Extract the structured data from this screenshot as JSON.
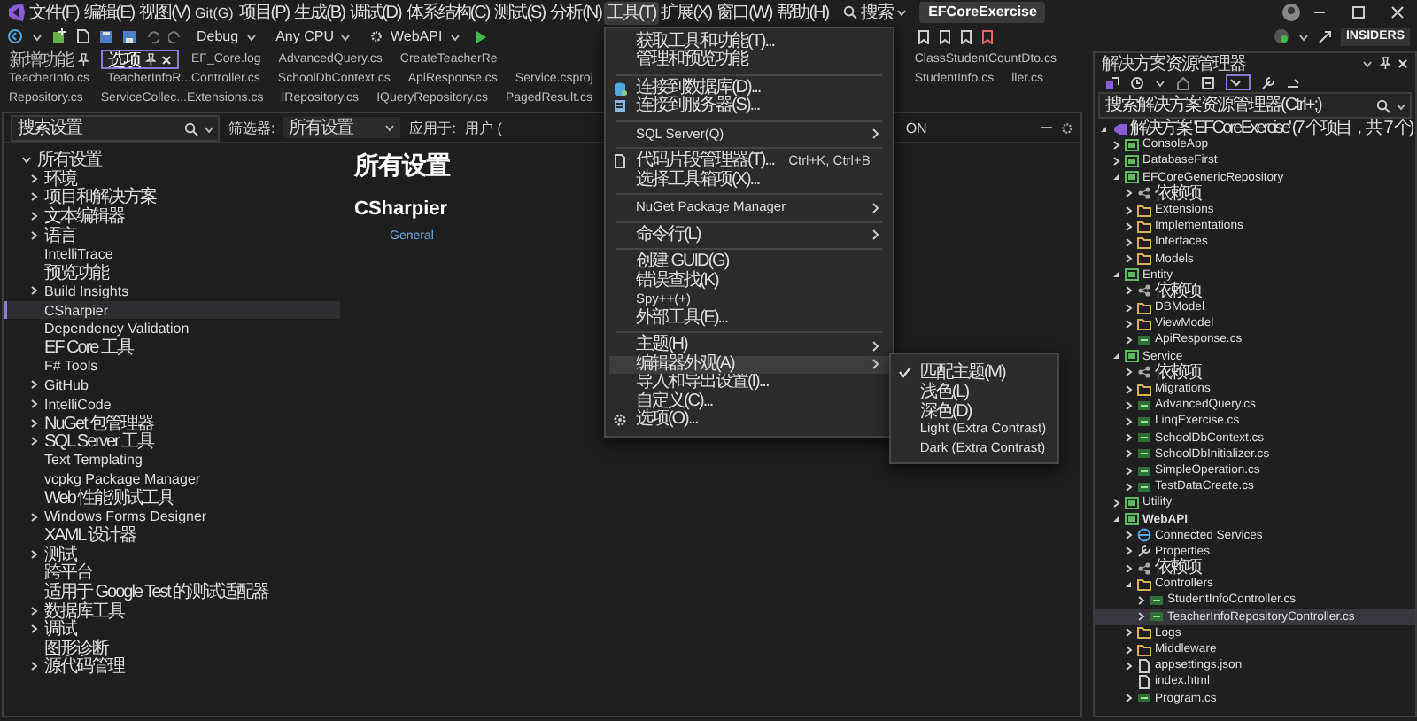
{
  "menubar": {
    "menus": [
      {
        "label": "文件(F)",
        "selected": false
      },
      {
        "label": "编辑(E)",
        "selected": false
      },
      {
        "label": "视图(V)",
        "selected": false
      },
      {
        "label": "Git(G)",
        "selected": false
      },
      {
        "label": "项目(P)",
        "selected": false
      },
      {
        "label": "生成(B)",
        "selected": false
      },
      {
        "label": "调试(D)",
        "selected": false
      },
      {
        "label": "体系结构(C)",
        "selected": false
      },
      {
        "label": "测试(S)",
        "selected": false
      },
      {
        "label": "分析(N)",
        "selected": false
      },
      {
        "label": "工具(T)",
        "selected": true
      },
      {
        "label": "扩展(X)",
        "selected": false
      },
      {
        "label": "窗口(W)",
        "selected": false
      },
      {
        "label": "帮助(H)",
        "selected": false
      }
    ],
    "search": "搜索",
    "title": "EFCoreExercise"
  },
  "tools_menu": [
    {
      "kind": "item",
      "label": "获取工具和功能(T)...",
      "selected": false
    },
    {
      "kind": "item",
      "label": "管理和预览功能",
      "selected": false
    },
    {
      "kind": "separator"
    },
    {
      "kind": "item",
      "label": "连接到数据库(D)...",
      "selected": false
    },
    {
      "kind": "item",
      "label": "连接到服务器(S)...",
      "selected": false
    },
    {
      "kind": "separator"
    },
    {
      "kind": "item",
      "label": "SQL Server(Q)",
      "submenu": true,
      "selected": false
    },
    {
      "kind": "separator"
    },
    {
      "kind": "item",
      "label": "代码片段管理器(T)...",
      "shortcut": "Ctrl+K, Ctrl+B",
      "selected": false
    },
    {
      "kind": "item",
      "label": "选择工具箱项(X)...",
      "selected": false
    },
    {
      "kind": "separator"
    },
    {
      "kind": "item",
      "label": "NuGet Package Manager",
      "submenu": true,
      "selected": false
    },
    {
      "kind": "separator"
    },
    {
      "kind": "item",
      "label": "命令行(L)",
      "submenu": true,
      "selected": false
    },
    {
      "kind": "separator"
    },
    {
      "kind": "item",
      "label": "创建 GUID(G)",
      "selected": false
    },
    {
      "kind": "item",
      "label": "错误查找(K)",
      "selected": false
    },
    {
      "kind": "item",
      "label": "Spy++(+)",
      "selected": false
    },
    {
      "kind": "item",
      "label": "外部工具(E)...",
      "selected": false
    },
    {
      "kind": "separator"
    },
    {
      "kind": "item",
      "label": "主题(H)",
      "submenu": true,
      "selected": false
    },
    {
      "kind": "item",
      "label": "编辑器外观(A)",
      "submenu": true,
      "selected": true,
      "submenu_items": [
        {
          "label": "匹配主题(M)",
          "checked": true
        },
        {
          "label": "浅色(L)",
          "checked": false
        },
        {
          "label": "深色(D)",
          "checked": false
        },
        {
          "label": "Light (Extra Contrast)",
          "checked": false
        },
        {
          "label": "Dark (Extra Contrast)",
          "checked": false
        }
      ]
    },
    {
      "kind": "item",
      "label": "导入和导出设置(I)...",
      "selected": false
    },
    {
      "kind": "item",
      "label": "自定义(C)...",
      "selected": false
    },
    {
      "kind": "item",
      "label": "选项(O)...",
      "selected": false
    }
  ],
  "toolbar": {
    "configuration": "Debug",
    "platform": "Any CPU",
    "startup": "WebAPI",
    "badge": "INSIDERS"
  },
  "doc_tabs": [
    {
      "label": "新增功能",
      "selected": false,
      "pinned": true
    },
    {
      "label": "选项",
      "selected": true,
      "pinned": true
    },
    {
      "label": "EF_Core.log",
      "selected": false,
      "pinned": false
    },
    {
      "label": "AdvancedQuery.cs",
      "selected": false,
      "pinned": false
    },
    {
      "label": "CreateTeacherRe",
      "selected": false,
      "pinned": false
    },
    {
      "label": "ClassStudentCountDto.cs",
      "selected": false,
      "pinned": false
    },
    {
      "label": "TeacherInfo.cs",
      "selected": false,
      "pinned": false
    },
    {
      "label": "TeacherInfoR...Controller.cs",
      "selected": false,
      "pinned": false
    },
    {
      "label": "SchoolDbContext.cs",
      "selected": false,
      "pinned": false
    },
    {
      "label": "ApiResponse.cs",
      "selected": false,
      "pinned": false
    },
    {
      "label": "Service.csproj",
      "selected": false,
      "pinned": false
    },
    {
      "label": "StudentInfo.cs",
      "selected": false,
      "pinned": false
    },
    {
      "label": "ller.cs",
      "selected": false,
      "pinned": false
    },
    {
      "label": "Repository.cs",
      "selected": false,
      "pinned": false
    },
    {
      "label": "ServiceCollec...Extensions.cs",
      "selected": false,
      "pinned": false
    },
    {
      "label": "IRepository.cs",
      "selected": false,
      "pinned": false
    },
    {
      "label": "IQueryRepository.cs",
      "selected": false,
      "pinned": false
    },
    {
      "label": "PagedResult.cs",
      "selected": false,
      "pinned": false
    }
  ],
  "options": {
    "search": {
      "placeholder": "搜索设置"
    },
    "filter_label": "筛选器:",
    "filter_value": "所有设置",
    "scope_label": "应用于:",
    "scope_value": "用户 (",
    "fragment": "ON",
    "tree": [
      {
        "label": "所有设置",
        "expanded": true,
        "selected": false,
        "children": [
          {
            "label": "环境",
            "expanded": false,
            "selected": false
          },
          {
            "label": "项目和解决方案",
            "expanded": false,
            "selected": false
          },
          {
            "label": "文本编辑器",
            "expanded": false,
            "selected": false
          },
          {
            "label": "语言",
            "expanded": false,
            "selected": false
          },
          {
            "label": "IntelliTrace",
            "selected": false
          },
          {
            "label": "预览功能",
            "selected": false
          },
          {
            "label": "Build Insights",
            "expanded": false,
            "selected": false
          },
          {
            "label": "CSharpier",
            "selected": true
          },
          {
            "label": "Dependency Validation",
            "selected": false
          },
          {
            "label": "EF Core 工具",
            "selected": false
          },
          {
            "label": "F# Tools",
            "selected": false
          },
          {
            "label": "GitHub",
            "expanded": false,
            "selected": false
          },
          {
            "label": "IntelliCode",
            "expanded": false,
            "selected": false
          },
          {
            "label": "NuGet 包管理器",
            "expanded": false,
            "selected": false
          },
          {
            "label": "SQL Server 工具",
            "expanded": false,
            "selected": false
          },
          {
            "label": "Text Templating",
            "selected": false
          },
          {
            "label": "vcpkg Package Manager",
            "selected": false
          },
          {
            "label": "Web 性能测试工具",
            "selected": false
          },
          {
            "label": "Windows Forms Designer",
            "expanded": false,
            "selected": false
          },
          {
            "label": "XAML 设计器",
            "selected": false
          },
          {
            "label": "测试",
            "expanded": false,
            "selected": false
          },
          {
            "label": "跨平台",
            "selected": false
          },
          {
            "label": "适用于 Google Test 的测试适配器",
            "selected": false
          },
          {
            "label": "数据库工具",
            "expanded": false,
            "selected": false
          },
          {
            "label": "调试",
            "expanded": false,
            "selected": false
          },
          {
            "label": "图形诊断",
            "selected": false
          },
          {
            "label": "源代码管理",
            "expanded": false,
            "selected": false
          }
        ]
      }
    ],
    "heading": "所有设置",
    "subheading": "CSharpier",
    "link": "General"
  },
  "solution_explorer": {
    "title": "解决方案资源管理器",
    "search": {
      "placeholder": "搜索解决方案资源管理器(Ctrl+;)"
    },
    "tree": [
      {
        "kind": "solution",
        "label": "解决方案 'EFCoreExercise' (7 个项目，共 7 个)",
        "expanded": true,
        "selected": false,
        "children": [
          {
            "kind": "project",
            "label": "ConsoleApp",
            "expanded": false,
            "selected": false,
            "startup": false
          },
          {
            "kind": "project",
            "label": "DatabaseFirst",
            "expanded": false,
            "selected": false,
            "startup": false
          },
          {
            "kind": "project",
            "label": "EFCoreGenericRepository",
            "expanded": true,
            "selected": false,
            "startup": false,
            "children": [
              {
                "kind": "deps",
                "label": "依赖项",
                "expanded": false,
                "selected": false
              },
              {
                "kind": "folder",
                "label": "Extensions",
                "expanded": false,
                "selected": false
              },
              {
                "kind": "folder",
                "label": "Implementations",
                "expanded": false,
                "selected": false
              },
              {
                "kind": "folder",
                "label": "Interfaces",
                "expanded": false,
                "selected": false
              },
              {
                "kind": "folder",
                "label": "Models",
                "expanded": false,
                "selected": false
              }
            ]
          },
          {
            "kind": "project",
            "label": "Entity",
            "expanded": true,
            "selected": false,
            "startup": false,
            "children": [
              {
                "kind": "deps",
                "label": "依赖项",
                "expanded": false,
                "selected": false
              },
              {
                "kind": "folder",
                "label": "DBModel",
                "expanded": false,
                "selected": false
              },
              {
                "kind": "folder",
                "label": "ViewModel",
                "expanded": false,
                "selected": false
              },
              {
                "kind": "cs",
                "label": "ApiResponse.cs",
                "expanded": false,
                "selected": false
              }
            ]
          },
          {
            "kind": "project",
            "label": "Service",
            "expanded": true,
            "selected": false,
            "startup": false,
            "children": [
              {
                "kind": "deps",
                "label": "依赖项",
                "expanded": false,
                "selected": false
              },
              {
                "kind": "folder",
                "label": "Migrations",
                "expanded": false,
                "selected": false
              },
              {
                "kind": "cs",
                "label": "AdvancedQuery.cs",
                "expanded": false,
                "selected": false
              },
              {
                "kind": "cs",
                "label": "LinqExercise.cs",
                "expanded": false,
                "selected": false
              },
              {
                "kind": "cs",
                "label": "SchoolDbContext.cs",
                "expanded": false,
                "selected": false
              },
              {
                "kind": "cs",
                "label": "SchoolDbInitializer.cs",
                "expanded": false,
                "selected": false
              },
              {
                "kind": "cs",
                "label": "SimpleOperation.cs",
                "expanded": false,
                "selected": false
              },
              {
                "kind": "cs",
                "label": "TestDataCreate.cs",
                "expanded": false,
                "selected": false
              }
            ]
          },
          {
            "kind": "project",
            "label": "Utility",
            "expanded": false,
            "selected": false,
            "startup": false
          },
          {
            "kind": "project",
            "label": "WebAPI",
            "expanded": true,
            "selected": false,
            "startup": true,
            "children": [
              {
                "kind": "services",
                "label": "Connected Services",
                "expanded": false,
                "selected": false
              },
              {
                "kind": "properties",
                "label": "Properties",
                "expanded": false,
                "selected": false
              },
              {
                "kind": "deps",
                "label": "依赖项",
                "expanded": false,
                "selected": false
              },
              {
                "kind": "folder",
                "label": "Controllers",
                "expanded": true,
                "selected": false,
                "children": [
                  {
                    "kind": "cs",
                    "label": "StudentInfoController.cs",
                    "expanded": false,
                    "selected": false
                  },
                  {
                    "kind": "cs",
                    "label": "TeacherInfoRepositoryController.cs",
                    "expanded": false,
                    "selected": true
                  }
                ]
              },
              {
                "kind": "folder",
                "label": "Logs",
                "expanded": false,
                "selected": false
              },
              {
                "kind": "folder",
                "label": "Middleware",
                "expanded": false,
                "selected": false
              },
              {
                "kind": "json",
                "label": "appsettings.json",
                "expanded": false,
                "selected": false
              },
              {
                "kind": "html",
                "label": "index.html",
                "selected": false
              },
              {
                "kind": "cs",
                "label": "Program.cs",
                "expanded": false,
                "selected": false
              }
            ]
          }
        ]
      }
    ]
  }
}
